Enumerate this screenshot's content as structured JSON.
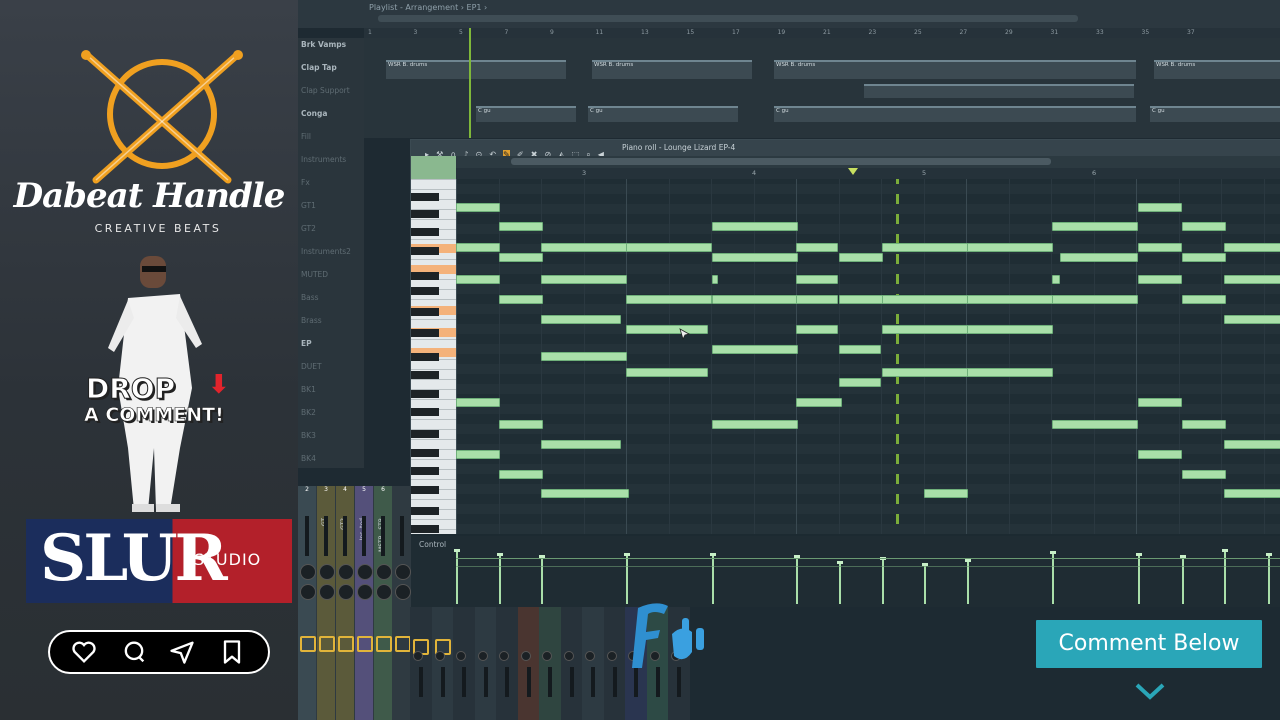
{
  "promo": {
    "brand_name": "Dabeat Handle",
    "brand_tagline": "CREATIVE BEATS",
    "cta_line1": "DROP",
    "cta_line2": "A COMMENT!",
    "studio_logo": "SLUR",
    "studio_logo_sub": "STUDIO",
    "social_icons": [
      "heart-icon",
      "comment-icon",
      "send-icon",
      "bookmark-icon"
    ],
    "colors": {
      "brand_orange": "#f0a020",
      "slur_blue": "#1b2d5c",
      "slur_red": "#b3202a",
      "arrow_red": "#e2242c"
    }
  },
  "playlist": {
    "title": "Playlist - Arrangement",
    "pattern": "EP1",
    "tracks": [
      "Brk Vamps",
      "Clap Tap",
      "Clap Support",
      "Conga",
      "Fill",
      "Instruments",
      "Fx",
      "GT1",
      "GT2",
      "Instruments2",
      "MUTED",
      "Bass",
      "Brass",
      "EP",
      "DUET",
      "BK1",
      "BK2",
      "BK3",
      "BK4"
    ],
    "ruler_numbers": [
      "1",
      "3",
      "5",
      "7",
      "9",
      "11",
      "13",
      "15",
      "17",
      "19",
      "21",
      "23",
      "25",
      "27",
      "29",
      "31",
      "33",
      "35",
      "37"
    ],
    "clip_label": "WSR B. drums",
    "clip_label2": "C gu"
  },
  "piano_roll": {
    "title": "Piano roll - Lounge Lizard EP-4",
    "ruler_numbers": [
      "3",
      "4",
      "5",
      "6"
    ],
    "control_label": "Control",
    "accent": "#a9dfa9"
  },
  "mixer": {
    "strip_numbers": [
      "2",
      "3",
      "4",
      "5",
      "6"
    ],
    "strip_labels": [
      "GT",
      "GT2",
      "Ins..ted",
      "MSTR...STR"
    ]
  },
  "overlay": {
    "comment_button": "Comment Below",
    "accent": "#2aa6b8"
  }
}
